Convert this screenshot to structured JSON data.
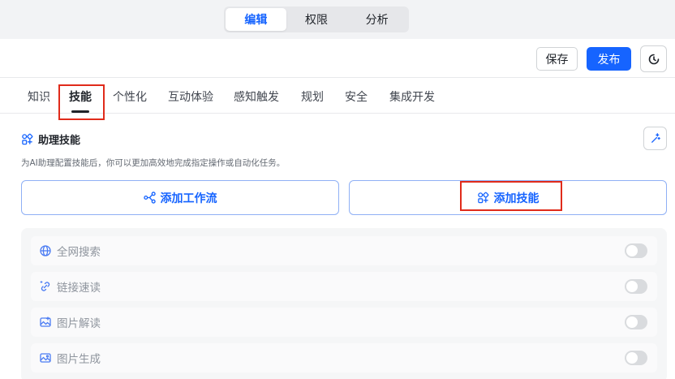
{
  "top_segment": {
    "items": [
      "编辑",
      "权限",
      "分析"
    ],
    "active_index": 0
  },
  "toolbar": {
    "save_label": "保存",
    "publish_label": "发布",
    "history_icon": "history-icon"
  },
  "tabs": {
    "items": [
      "知识",
      "技能",
      "个性化",
      "互动体验",
      "感知触发",
      "规划",
      "安全",
      "集成开发"
    ],
    "active_index": 1
  },
  "skills": {
    "title": "助理技能",
    "description": "为AI助理配置技能后，你可以更加高效地完成指定操作或自动化任务。",
    "add_workflow_label": "添加工作流",
    "add_skill_label": "添加技能",
    "list": [
      {
        "name": "全网搜索",
        "icon": "globe-icon",
        "enabled": false
      },
      {
        "name": "链接速读",
        "icon": "link-read-icon",
        "enabled": false
      },
      {
        "name": "图片解读",
        "icon": "image-read-icon",
        "enabled": false
      },
      {
        "name": "图片生成",
        "icon": "image-generate-icon",
        "enabled": false
      }
    ]
  },
  "colors": {
    "accent": "#1664ff",
    "highlight_box": "#e02b1b"
  }
}
